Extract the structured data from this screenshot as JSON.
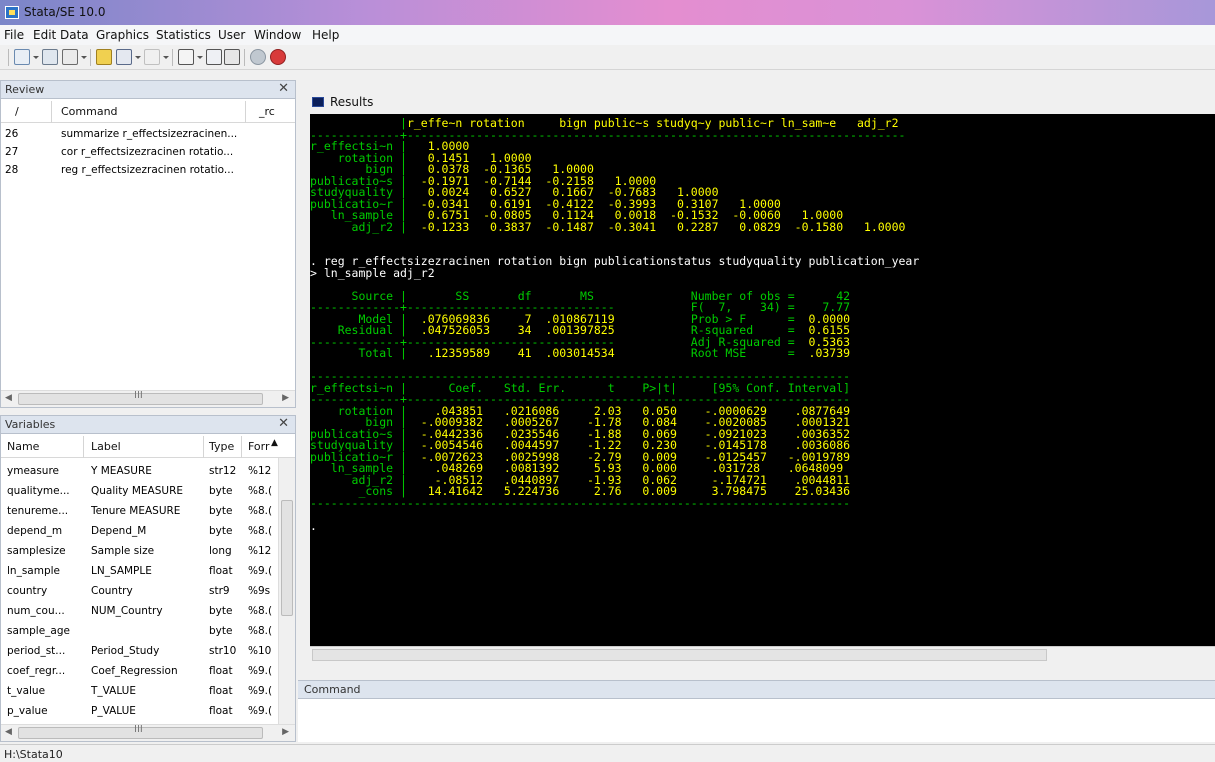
{
  "window": {
    "title": "Stata/SE 10.0"
  },
  "menu": [
    "File",
    "Edit",
    "Data",
    "Graphics",
    "Statistics",
    "User",
    "Window",
    "Help"
  ],
  "review": {
    "title": "Review",
    "columns": [
      "/",
      "Command",
      "_rc"
    ],
    "rows": [
      {
        "num": "26",
        "cmd": "summarize r_effectsizezracinen..."
      },
      {
        "num": "27",
        "cmd": "cor r_effectsizezracinen rotatio..."
      },
      {
        "num": "28",
        "cmd": "reg r_effectsizezracinen rotatio..."
      }
    ],
    "scroll_dots": "III"
  },
  "variables": {
    "title": "Variables",
    "columns": [
      "Name",
      "Label",
      "Type",
      "Forr"
    ],
    "rows": [
      {
        "name": "ymeasure",
        "label": "Y MEASURE",
        "type": "str12",
        "fmt": "%12"
      },
      {
        "name": "qualityme...",
        "label": "Quality MEASURE",
        "type": "byte",
        "fmt": "%8.("
      },
      {
        "name": "tenureme...",
        "label": "Tenure MEASURE",
        "type": "byte",
        "fmt": "%8.("
      },
      {
        "name": "depend_m",
        "label": "Depend_M",
        "type": "byte",
        "fmt": "%8.("
      },
      {
        "name": "samplesize",
        "label": "Sample size",
        "type": "long",
        "fmt": "%12"
      },
      {
        "name": "ln_sample",
        "label": "LN_SAMPLE",
        "type": "float",
        "fmt": "%9.("
      },
      {
        "name": "country",
        "label": "Country",
        "type": "str9",
        "fmt": "%9s"
      },
      {
        "name": "num_cou...",
        "label": "NUM_Country",
        "type": "byte",
        "fmt": "%8.("
      },
      {
        "name": "sample_age",
        "label": "",
        "type": "byte",
        "fmt": "%8.("
      },
      {
        "name": "period_st...",
        "label": "Period_Study",
        "type": "str10",
        "fmt": "%10"
      },
      {
        "name": "coef_regr...",
        "label": "Coef_Regression",
        "type": "float",
        "fmt": "%9.("
      },
      {
        "name": "t_value",
        "label": "T_VALUE",
        "type": "float",
        "fmt": "%9.("
      },
      {
        "name": "p_value",
        "label": "P_VALUE",
        "type": "float",
        "fmt": "%9.("
      }
    ],
    "scroll_dots": "III"
  },
  "results": {
    "title": "Results",
    "lines": [
      [
        {
          "c": "g",
          "t": "             |"
        },
        {
          "c": "y",
          "t": "r_effe~n rotation     bign public~s studyq~y public~r ln_sam~e   adj_r2"
        }
      ],
      [
        {
          "c": "g",
          "t": "-------------+------------------------------------------------------------------------"
        }
      ],
      [
        {
          "c": "g",
          "t": "r_effectsi~n |"
        },
        {
          "c": "y",
          "t": "   1.0000"
        }
      ],
      [
        {
          "c": "g",
          "t": "    rotation |"
        },
        {
          "c": "y",
          "t": "   0.1451   1.0000"
        }
      ],
      [
        {
          "c": "g",
          "t": "        bign |"
        },
        {
          "c": "y",
          "t": "   0.0378  -0.1365   1.0000"
        }
      ],
      [
        {
          "c": "g",
          "t": "publicatio~s |"
        },
        {
          "c": "y",
          "t": "  -0.1971  -0.7144  -0.2158   1.0000"
        }
      ],
      [
        {
          "c": "g",
          "t": "studyquality |"
        },
        {
          "c": "y",
          "t": "   0.0024   0.6527   0.1667  -0.7683   1.0000"
        }
      ],
      [
        {
          "c": "g",
          "t": "publicatio~r |"
        },
        {
          "c": "y",
          "t": "  -0.0341   0.6191  -0.4122  -0.3993   0.3107   1.0000"
        }
      ],
      [
        {
          "c": "g",
          "t": "   ln_sample |"
        },
        {
          "c": "y",
          "t": "   0.6751  -0.0805   0.1124   0.0018  -0.1532  -0.0060   1.0000"
        }
      ],
      [
        {
          "c": "g",
          "t": "      adj_r2 |"
        },
        {
          "c": "y",
          "t": "  -0.1233   0.3837  -0.1487  -0.3041   0.2287   0.0829  -0.1580   1.0000"
        }
      ],
      [
        {
          "c": "w",
          "t": ""
        }
      ],
      [
        {
          "c": "w",
          "t": ""
        }
      ],
      [
        {
          "c": "w",
          "t": ". reg r_effectsizezracinen rotation bign publicationstatus studyquality publication_year"
        }
      ],
      [
        {
          "c": "w",
          "t": "> ln_sample adj_r2"
        }
      ],
      [
        {
          "c": "w",
          "t": ""
        }
      ],
      [
        {
          "c": "g",
          "t": "      Source |       SS       df       MS              Number of obs =      42"
        }
      ],
      [
        {
          "c": "g",
          "t": "-------------+------------------------------           F(  7,    34) =    7.77"
        }
      ],
      [
        {
          "c": "g",
          "t": "       Model |"
        },
        {
          "c": "y",
          "t": "  .076069836     7  .010867119"
        },
        {
          "c": "g",
          "t": "           Prob > F      =  "
        },
        {
          "c": "y",
          "t": "0.0000"
        }
      ],
      [
        {
          "c": "g",
          "t": "    Residual |"
        },
        {
          "c": "y",
          "t": "  .047526053    34  .001397825"
        },
        {
          "c": "g",
          "t": "           R-squared     =  "
        },
        {
          "c": "y",
          "t": "0.6155"
        }
      ],
      [
        {
          "c": "g",
          "t": "-------------+------------------------------           Adj R-squared =  "
        },
        {
          "c": "y",
          "t": "0.5363"
        }
      ],
      [
        {
          "c": "g",
          "t": "       Total |"
        },
        {
          "c": "y",
          "t": "   .12359589    41  .003014534"
        },
        {
          "c": "g",
          "t": "           Root MSE      =  "
        },
        {
          "c": "y",
          "t": ".03739"
        }
      ],
      [
        {
          "c": "w",
          "t": ""
        }
      ],
      [
        {
          "c": "g",
          "t": "------------------------------------------------------------------------------"
        }
      ],
      [
        {
          "c": "g",
          "t": "r_effectsi~n |      Coef.   Std. Err.      t    P>|t|     [95% Conf. Interval]"
        }
      ],
      [
        {
          "c": "g",
          "t": "-------------+----------------------------------------------------------------"
        }
      ],
      [
        {
          "c": "g",
          "t": "    rotation |"
        },
        {
          "c": "y",
          "t": "    .043851   .0216086     2.03   0.050    -.0000629    .0877649"
        }
      ],
      [
        {
          "c": "g",
          "t": "        bign |"
        },
        {
          "c": "y",
          "t": "  -.0009382   .0005267    -1.78   0.084    -.0020085    .0001321"
        }
      ],
      [
        {
          "c": "g",
          "t": "publicatio~s |"
        },
        {
          "c": "y",
          "t": "  -.0442336   .0235546    -1.88   0.069    -.0921023    .0036352"
        }
      ],
      [
        {
          "c": "g",
          "t": "studyquality |"
        },
        {
          "c": "y",
          "t": "  -.0054546   .0044597    -1.22   0.230    -.0145178    .0036086"
        }
      ],
      [
        {
          "c": "g",
          "t": "publicatio~r |"
        },
        {
          "c": "y",
          "t": "  -.0072623   .0025998    -2.79   0.009    -.0125457   -.0019789"
        }
      ],
      [
        {
          "c": "g",
          "t": "   ln_sample |"
        },
        {
          "c": "y",
          "t": "    .048269   .0081392     5.93   0.000     .031728    .0648099"
        }
      ],
      [
        {
          "c": "g",
          "t": "      adj_r2 |"
        },
        {
          "c": "y",
          "t": "    -.08512   .0440897    -1.93   0.062     -.174721    .0044811"
        }
      ],
      [
        {
          "c": "g",
          "t": "       _cons |"
        },
        {
          "c": "y",
          "t": "   14.41642   5.224736     2.76   0.009     3.798475    25.03436"
        }
      ],
      [
        {
          "c": "g",
          "t": "------------------------------------------------------------------------------"
        }
      ],
      [
        {
          "c": "w",
          "t": ""
        }
      ],
      [
        {
          "c": "w",
          "t": "."
        }
      ]
    ]
  },
  "command": {
    "title": "Command",
    "value": ""
  },
  "status": {
    "path": "H:\\Stata10"
  }
}
